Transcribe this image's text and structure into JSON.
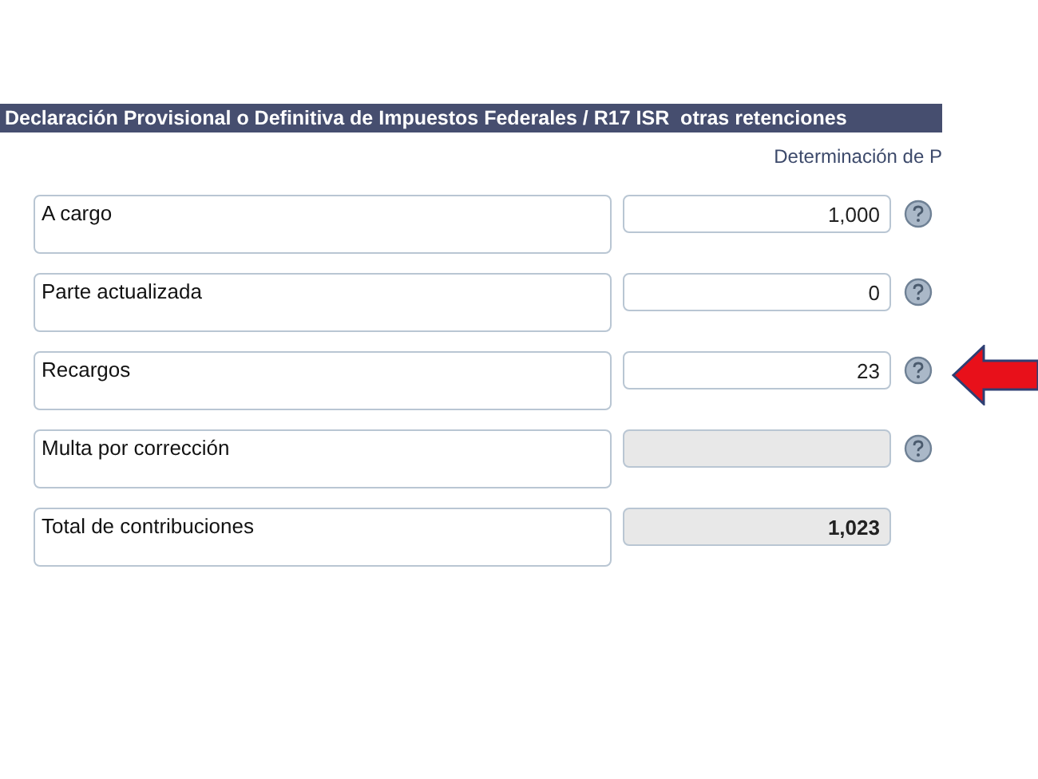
{
  "header": {
    "title": "Declaración Provisional o Definitiva de Impuestos Federales / R17 ISR  otras retenciones"
  },
  "section_title": "Determinación de P",
  "rows": [
    {
      "kind": "entry",
      "label": "A cargo",
      "value": "1,000",
      "disabled": false,
      "help": true,
      "highlighted": false
    },
    {
      "kind": "entry",
      "label": "Parte actualizada",
      "value": "0",
      "disabled": false,
      "help": true,
      "highlighted": false
    },
    {
      "kind": "entry",
      "label": "Recargos",
      "value": "23",
      "disabled": false,
      "help": true,
      "highlighted": true
    },
    {
      "kind": "entry",
      "label": "Multa por corrección",
      "disabled": true,
      "help": true,
      "highlighted": false
    },
    {
      "kind": "total",
      "label": "Total de contribuciones",
      "value": "1,023",
      "disabled": true,
      "help": false,
      "highlighted": false
    }
  ]
}
